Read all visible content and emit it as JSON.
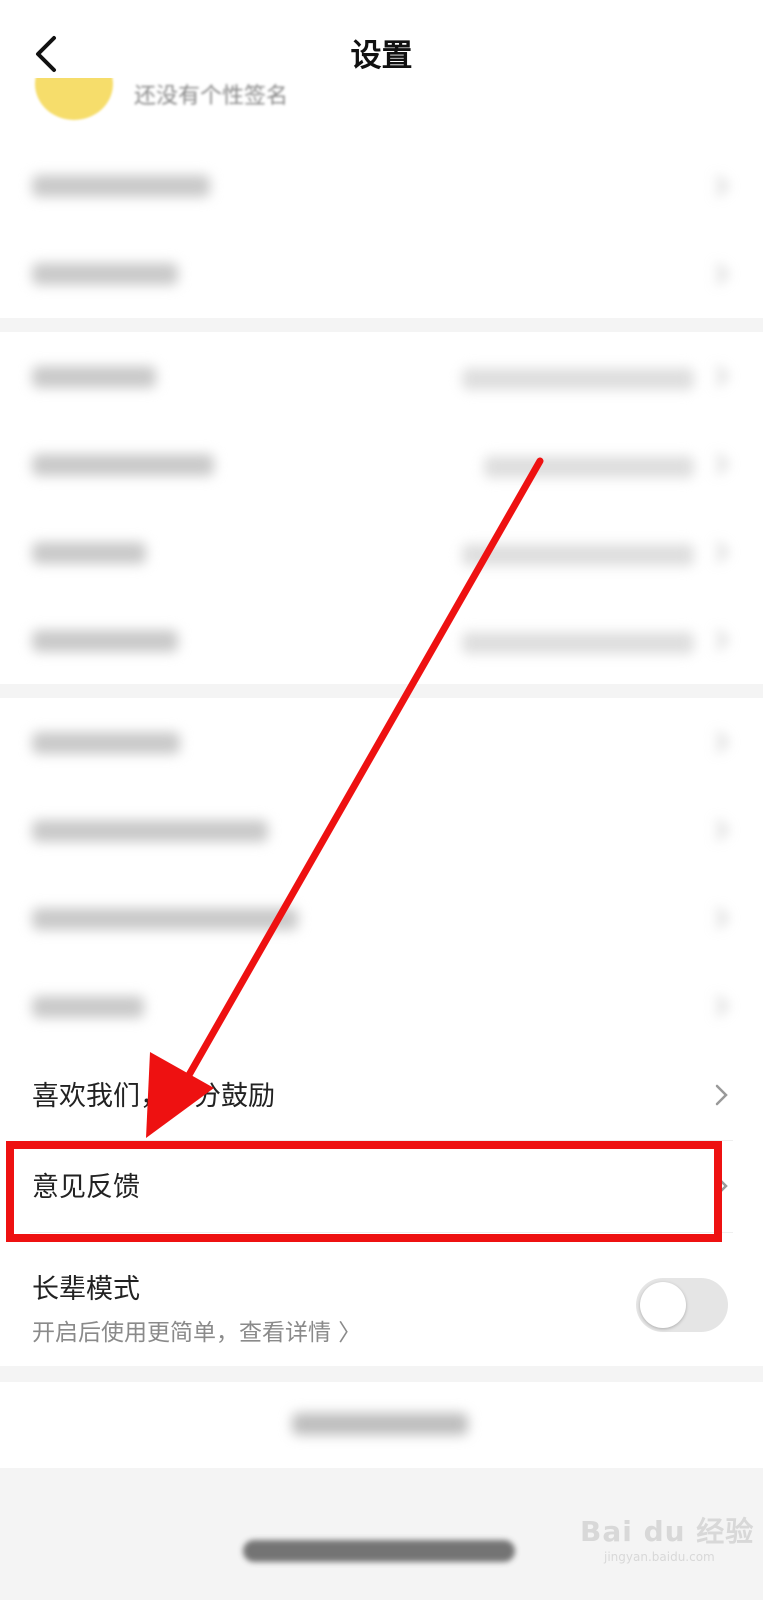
{
  "nav": {
    "title": "设置",
    "back_icon": "chevron-left-icon"
  },
  "profile": {
    "subtitle": "还没有个性签名"
  },
  "menu": {
    "liked_label": "喜欢我们，打分鼓励",
    "feedback_label": "意见反馈",
    "elder_mode": {
      "label": "长辈模式",
      "description": "开启后使用更简单，查看详情 〉",
      "enabled": false
    }
  },
  "colors": {
    "highlight": "#ee1111",
    "arrow": "#ee1111",
    "page_bg": "#f4f4f4"
  },
  "watermark": {
    "text": "Bai du 经验",
    "sub": "jingyan.baidu.com"
  }
}
